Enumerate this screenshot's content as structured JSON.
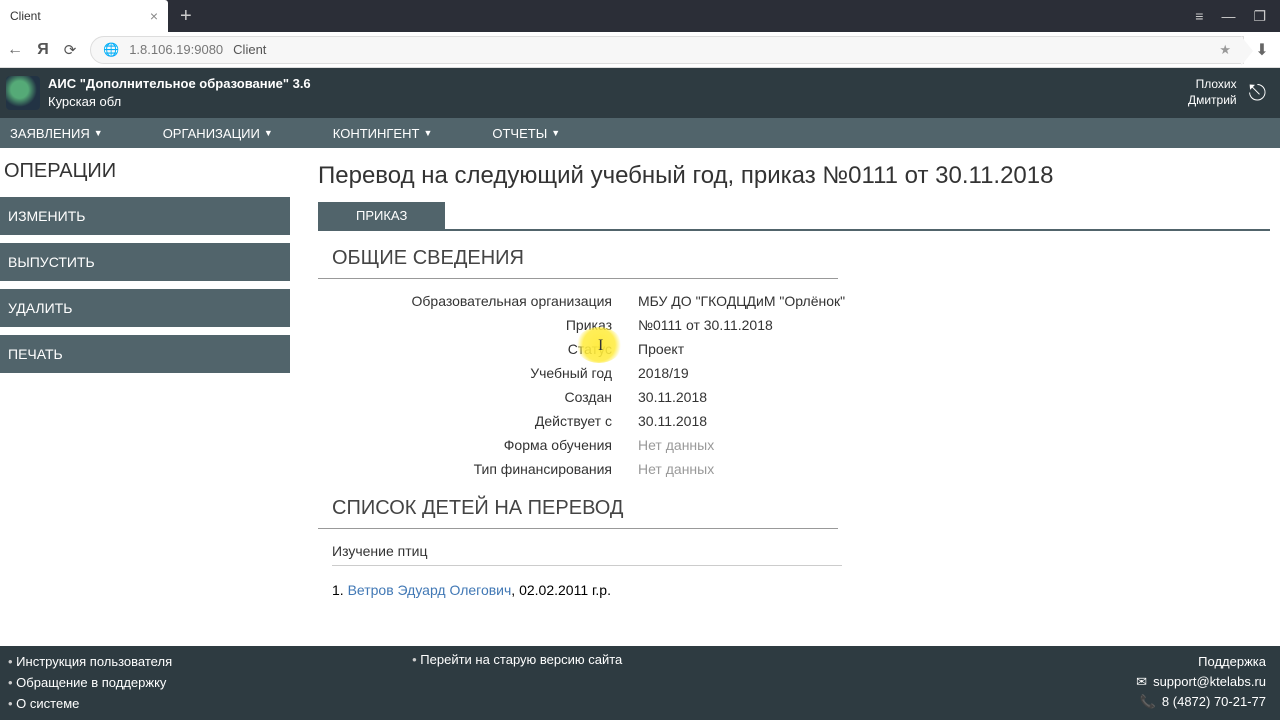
{
  "browser": {
    "tab_title": "Client",
    "address_host": "1.8.106.19:9080",
    "address_path": "Client"
  },
  "app_header": {
    "title": "АИС \"Дополнительное образование\" 3.6",
    "region": "Курская обл",
    "user_line1": "Плохих",
    "user_line2": "Дмитрий"
  },
  "main_nav": {
    "applications": "ЗАЯВЛЕНИЯ",
    "organizations": "ОРГАНИЗАЦИИ",
    "contingent": "КОНТИНГЕНТ",
    "reports": "ОТЧЕТЫ"
  },
  "sidebar": {
    "title": "ОПЕРАЦИИ",
    "ops": {
      "edit": "ИЗМЕНИТЬ",
      "release": "ВЫПУСТИТЬ",
      "delete": "УДАЛИТЬ",
      "print": "ПЕЧАТЬ"
    }
  },
  "page": {
    "title": "Перевод на следующий учебный год, приказ №0111 от 30.11.2018",
    "tab": "ПРИКАЗ",
    "section_general": "ОБЩИЕ СВЕДЕНИЯ",
    "fields": {
      "org_label": "Образовательная организация",
      "org_val": "МБУ ДО \"ГКОДЦДиМ \"Орлёнок\"",
      "order_label": "Приказ",
      "order_val": "№0111 от 30.11.2018",
      "status_label": "Статус",
      "status_val": "Проект",
      "year_label": "Учебный год",
      "year_val": "2018/19",
      "created_label": "Создан",
      "created_val": "30.11.2018",
      "effective_label": "Действует с",
      "effective_val": "30.11.2018",
      "form_label": "Форма обучения",
      "form_val": "Нет данных",
      "finance_label": "Тип финансирования",
      "finance_val": "Нет данных"
    },
    "section_children": "СПИСОК ДЕТЕЙ НА ПЕРЕВОД",
    "group_name": "Изучение птиц",
    "child_idx": "1. ",
    "child_name": "Ветров Эдуард Олегович",
    "child_suffix": ", 02.02.2011 г.р."
  },
  "footer": {
    "left1": "Инструкция пользователя",
    "left2": "Обращение в поддержку",
    "left3": "О системе",
    "mid": "Перейти на старую версию сайта",
    "right_title": "Поддержка",
    "right_email": "support@ktelabs.ru",
    "right_phone": "8 (4872) 70-21-77"
  }
}
